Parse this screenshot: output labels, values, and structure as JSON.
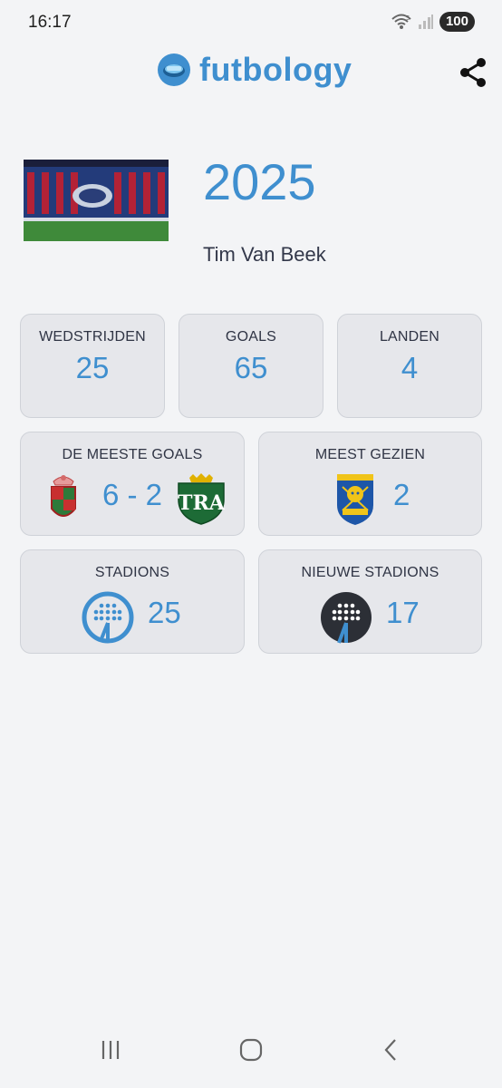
{
  "status_bar": {
    "time": "16:17",
    "battery": "100"
  },
  "header": {
    "app_name": "futbology",
    "share_icon": "share-icon"
  },
  "hero": {
    "year": "2025",
    "user_name": "Tim Van Beek"
  },
  "stats": {
    "matches": {
      "label": "WEDSTRIJDEN",
      "value": "25"
    },
    "goals": {
      "label": "GOALS",
      "value": "65"
    },
    "countries": {
      "label": "LANDEN",
      "value": "4"
    }
  },
  "most_goals": {
    "label": "DE MEESTE GOALS",
    "score": "6 - 2"
  },
  "most_seen": {
    "label": "MEEST GEZIEN",
    "value": "2"
  },
  "stadiums": {
    "label": "STADIONS",
    "value": "25"
  },
  "new_stadiums": {
    "label": "NIEUWE STADIONS",
    "value": "17"
  },
  "colors": {
    "accent": "#3f8fcf",
    "background": "#f3f4f6",
    "card": "#e6e7eb"
  }
}
